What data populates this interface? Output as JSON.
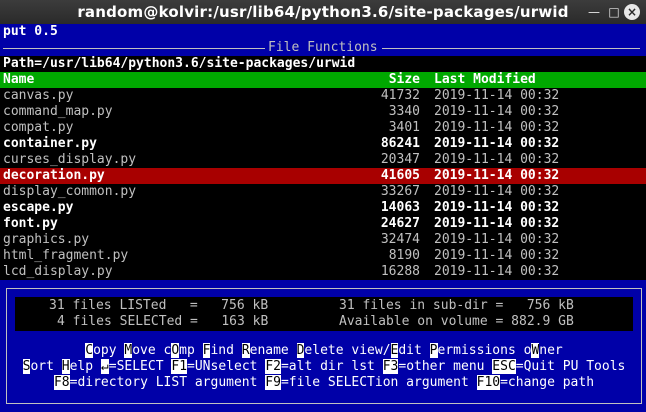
{
  "window": {
    "title": "random@kolvir:/usr/lib64/python3.6/site-packages/urwid"
  },
  "top_line": "put 0.5",
  "section_title": "File Functions",
  "path_line": "Path=/usr/lib64/python3.6/site-packages/urwid",
  "columns": {
    "name": "Name",
    "size": "Size",
    "modified": "Last Modified"
  },
  "files": [
    {
      "name": "canvas.py",
      "size": "41732",
      "modified": "2019-11-14 00:32",
      "bold": false,
      "selected": false
    },
    {
      "name": "command_map.py",
      "size": "3340",
      "modified": "2019-11-14 00:32",
      "bold": false,
      "selected": false
    },
    {
      "name": "compat.py",
      "size": "3401",
      "modified": "2019-11-14 00:32",
      "bold": false,
      "selected": false
    },
    {
      "name": "container.py",
      "size": "86241",
      "modified": "2019-11-14 00:32",
      "bold": true,
      "selected": false
    },
    {
      "name": "curses_display.py",
      "size": "20347",
      "modified": "2019-11-14 00:32",
      "bold": false,
      "selected": false
    },
    {
      "name": "decoration.py",
      "size": "41605",
      "modified": "2019-11-14 00:32",
      "bold": true,
      "selected": true
    },
    {
      "name": "display_common.py",
      "size": "33267",
      "modified": "2019-11-14 00:32",
      "bold": false,
      "selected": false
    },
    {
      "name": "escape.py",
      "size": "14063",
      "modified": "2019-11-14 00:32",
      "bold": true,
      "selected": false
    },
    {
      "name": "font.py",
      "size": "24627",
      "modified": "2019-11-14 00:32",
      "bold": true,
      "selected": false
    },
    {
      "name": "graphics.py",
      "size": "32474",
      "modified": "2019-11-14 00:32",
      "bold": false,
      "selected": false
    },
    {
      "name": "html_fragment.py",
      "size": "8190",
      "modified": "2019-11-14 00:32",
      "bold": false,
      "selected": false
    },
    {
      "name": "lcd_display.py",
      "size": "16288",
      "modified": "2019-11-14 00:32",
      "bold": false,
      "selected": false
    }
  ],
  "stats": {
    "listed": "31 files LISTed   =   756 kB",
    "selected": "4 files SELECTed =   163 kB",
    "subdir": "31 files in sub-dir =   756 kB",
    "available": "Available on volume = 882.9 GB"
  },
  "menu1": [
    {
      "key": "C",
      "rest": "opy"
    },
    {
      "key": "M",
      "rest": "ove"
    },
    {
      "pre": "c",
      "key": "O",
      "rest": "mp"
    },
    {
      "key": "F",
      "rest": "ind"
    },
    {
      "key": "R",
      "rest": "ename"
    },
    {
      "key": "D",
      "rest": "elete"
    },
    {
      "pre": "view/",
      "key": "E",
      "rest": "dit"
    },
    {
      "key": "P",
      "rest": "ermissions"
    },
    {
      "pre": "o",
      "key": "W",
      "rest": "ner"
    }
  ],
  "menu2": [
    {
      "key": "S",
      "rest": "ort"
    },
    {
      "key": "H",
      "rest": "elp"
    },
    {
      "key": "↵",
      "rest": "=SELECT"
    },
    {
      "key": "F1",
      "rest": "=UNselect"
    },
    {
      "key": "F2",
      "rest": "=alt dir lst"
    },
    {
      "key": "F3",
      "rest": "=other menu"
    },
    {
      "key": "ESC",
      "rest": "=Quit PU Tools"
    }
  ],
  "menu3": [
    {
      "key": "F8",
      "rest": "=directory LIST argument"
    },
    {
      "key": "F9",
      "rest": "=file SELECTion argument"
    },
    {
      "key": "F10",
      "rest": "=change path"
    }
  ],
  "colors": {
    "background": "#0000a8",
    "header": "#00a800",
    "selected_row": "#a80000",
    "list_bg": "#000000"
  }
}
